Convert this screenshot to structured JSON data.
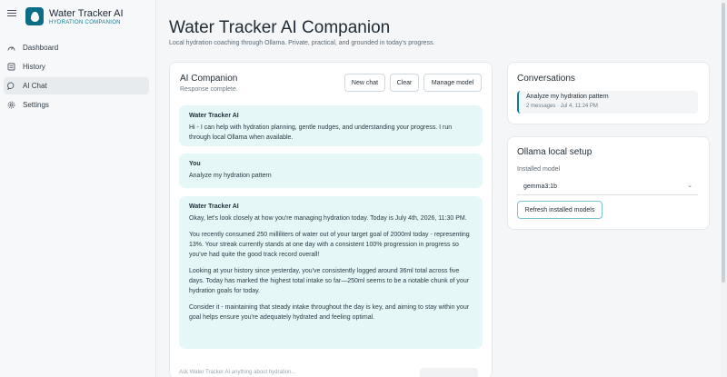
{
  "app": {
    "title": "Water Tracker AI",
    "subtitle": "HYDRATION COMPANION"
  },
  "sidebar": {
    "items": [
      {
        "label": "Dashboard",
        "icon": "dashboard-icon",
        "active": false
      },
      {
        "label": "History",
        "icon": "history-icon",
        "active": false
      },
      {
        "label": "AI Chat",
        "icon": "chat-icon",
        "active": true
      },
      {
        "label": "Settings",
        "icon": "gear-icon",
        "active": false
      }
    ]
  },
  "main": {
    "title": "Water Tracker AI Companion",
    "subtitle": "Local hydration coaching through Ollama. Private, practical, and grounded in today's progress."
  },
  "chat": {
    "title": "AI Companion",
    "status": "Response complete.",
    "buttons": {
      "new_chat": "New chat",
      "clear": "Clear",
      "manage_model": "Manage model"
    },
    "messages": [
      {
        "sender": "Water Tracker AI",
        "paragraphs": [
          "Hi - I can help with hydration planning, gentle nudges, and understanding your progress. I run through local Ollama when available."
        ]
      },
      {
        "sender": "You",
        "paragraphs": [
          "Analyze my hydration pattern"
        ]
      },
      {
        "sender": "Water Tracker AI",
        "paragraphs": [
          "Okay, let's look closely at how you're managing hydration today. Today is July 4th, 2026, 11:30 PM.",
          "You recently consumed 250 milliliters of water out of your target goal of 2000ml today - representing 13%. Your streak currently stands at one day with a consistent 100% progression in progress so you've had quite the good track record overall!",
          "Looking at your history since yesterday, you've consistently logged around 36ml total across five days. Today has marked the highest total intake so far—250ml seems to be a notable chunk of your hydration goals for today.",
          "Consider it - maintaining that steady intake throughout the day is key, and aiming to stay within your goal helps ensure you're adequately hydrated and feeling optimal."
        ]
      }
    ],
    "composer_placeholder": "Ask Water Tracker AI anything about hydration..."
  },
  "conversations": {
    "title": "Conversations",
    "items": [
      {
        "name": "Analyze my hydration pattern",
        "meta": "2 messages · Jul 4, 11:24 PM"
      }
    ]
  },
  "ollama": {
    "title": "Ollama local setup",
    "installed_label": "Installed model",
    "selected_model": "gemma3:1b",
    "refresh_label": "Refresh installed models"
  },
  "colors": {
    "accent": "#0b7f99",
    "bubble": "#e6f7f7"
  }
}
